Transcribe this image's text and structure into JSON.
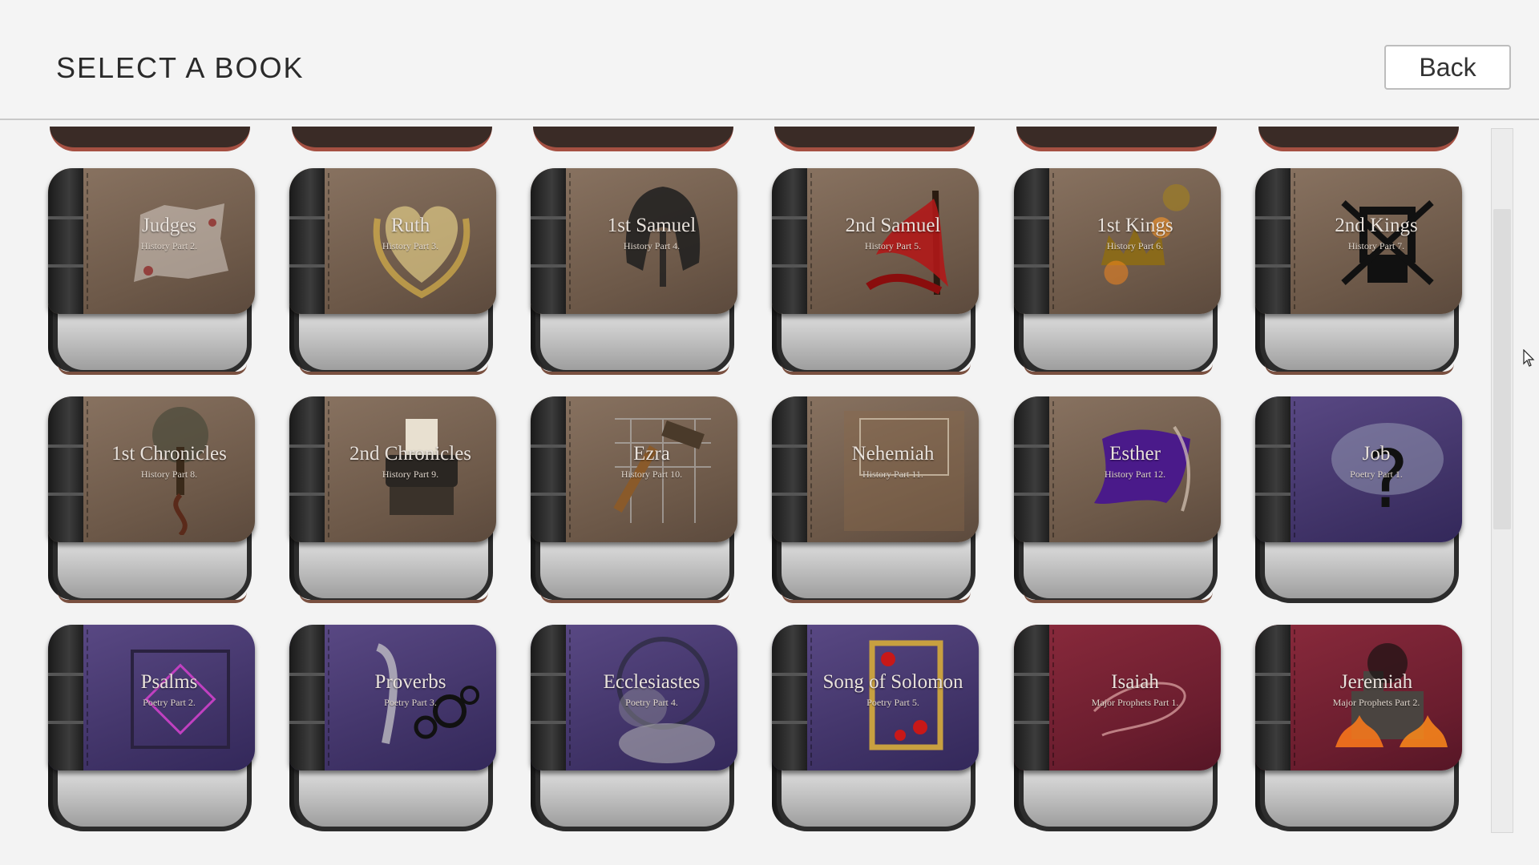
{
  "header": {
    "title": "SELECT A BOOK",
    "back_label": "Back"
  },
  "books": [
    {
      "name": "Judges",
      "sub": "History Part 2.",
      "theme": "brown",
      "icon": "torn-paper-icon"
    },
    {
      "name": "Ruth",
      "sub": "History Part 3.",
      "theme": "brown",
      "icon": "wheat-heart-icon"
    },
    {
      "name": "1st Samuel",
      "sub": "History Part 4.",
      "theme": "brown",
      "icon": "helmet-icon"
    },
    {
      "name": "2nd Samuel",
      "sub": "History Part 5.",
      "theme": "brown",
      "icon": "red-flag-icon"
    },
    {
      "name": "1st Kings",
      "sub": "History Part 6.",
      "theme": "brown",
      "icon": "crown-fire-icon"
    },
    {
      "name": "2nd Kings",
      "sub": "History Part 7.",
      "theme": "brown",
      "icon": "throne-crossed-icon"
    },
    {
      "name": "1st Chronicles",
      "sub": "History Part 8.",
      "theme": "brown",
      "icon": "tree-icon"
    },
    {
      "name": "2nd Chronicles",
      "sub": "History Part 9.",
      "theme": "brown",
      "icon": "typewriter-icon"
    },
    {
      "name": "Ezra",
      "sub": "History Part 10.",
      "theme": "brown",
      "icon": "hammer-icon"
    },
    {
      "name": "Nehemiah",
      "sub": "History Part 11.",
      "theme": "brown",
      "icon": "wall-icon"
    },
    {
      "name": "Esther",
      "sub": "History Part 12.",
      "theme": "brown",
      "icon": "purple-cloth-icon"
    },
    {
      "name": "Job",
      "sub": "Poetry Part 1.",
      "theme": "purple",
      "icon": "question-cloud-icon"
    },
    {
      "name": "Psalms",
      "sub": "Poetry Part 2.",
      "theme": "purple",
      "icon": "puzzle-icon"
    },
    {
      "name": "Proverbs",
      "sub": "Poetry Part 3.",
      "theme": "purple",
      "icon": "quill-gears-icon"
    },
    {
      "name": "Ecclesiastes",
      "sub": "Poetry Part 4.",
      "theme": "purple",
      "icon": "smoke-icon"
    },
    {
      "name": "Song of Solomon",
      "sub": "Poetry Part 5.",
      "theme": "purple",
      "icon": "rose-frame-icon"
    },
    {
      "name": "Isaiah",
      "sub": "Major Prophets Part 1.",
      "theme": "red",
      "icon": "swirl-icon"
    },
    {
      "name": "Jeremiah",
      "sub": "Major Prophets Part 2.",
      "theme": "red",
      "icon": "burning-city-icon"
    }
  ],
  "colors": {
    "brown": "#7a6453",
    "purple": "#45376f",
    "red": "#6e1f31"
  }
}
